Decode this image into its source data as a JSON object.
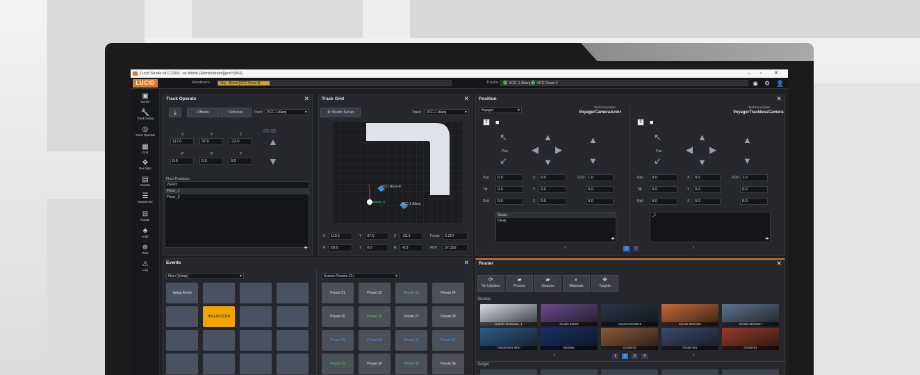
{
  "window": {
    "title": "Lucid Studio v4.0.2204 - as Admin [Administrator][port:5454]"
  },
  "appbar": {
    "logo": "LUCID",
    "renderers_label": "Renderers:",
    "renderer_chip": "Voy - Boost [VCC Ross-4]",
    "tracks_label": "Tracks:",
    "tracks": [
      "VCC-1 Alienj",
      "VCC Ross-4"
    ]
  },
  "sidebar": {
    "items": [
      {
        "label": "Server",
        "icon": "server-icon",
        "glyph": "▣"
      },
      {
        "label": "Track Setup",
        "icon": "wrench-icon",
        "glyph": "🔧"
      },
      {
        "label": "Track Operate",
        "icon": "target-icon",
        "glyph": "◎"
      },
      {
        "label": "Grid",
        "icon": "grid-icon",
        "glyph": "▦"
      },
      {
        "label": "Pos Man",
        "icon": "move-icon",
        "glyph": "✥"
      },
      {
        "label": "Events",
        "icon": "events-icon",
        "glyph": "▤"
      },
      {
        "label": "Sequencer",
        "icon": "sequencer-icon",
        "glyph": "☰"
      },
      {
        "label": "Router",
        "icon": "router-icon",
        "glyph": "⊟"
      },
      {
        "label": "Logic",
        "icon": "logic-icon",
        "glyph": "♣"
      },
      {
        "label": "Web",
        "icon": "web-icon",
        "glyph": "⊕"
      },
      {
        "label": "Log",
        "icon": "warning-icon",
        "glyph": "⚠"
      }
    ]
  },
  "track_operate": {
    "title": "Track Operate",
    "offsets": "Offsets",
    "defocus": "Defocus",
    "track_label": "Track:",
    "track_value": "VCC-1 Alienj",
    "xyz_labels": [
      "X",
      "Y",
      "Z"
    ],
    "xyz": [
      "117.0",
      "37.0",
      "-23.0"
    ],
    "prp_labels": [
      "P",
      "R",
      "F"
    ],
    "prp": [
      "0.0",
      "0.0",
      "0.0"
    ],
    "floor_label": "Floor Positions:",
    "floor_positions": [
      "ZERO",
      "Floor_1",
      "Floor_2"
    ]
  },
  "track_grid": {
    "title": "Track Grid",
    "studio_setup": "Studio Setup",
    "track_label": "Track:",
    "track_value": "VCC-1 Alienj",
    "cam1": "VCC Ross-4",
    "cam2": "VCC-1 Alienj",
    "axis_z": "Z",
    "axis_x": "X",
    "x_label": "X",
    "x": "119.1",
    "y_label": "Y",
    "y": "37.0",
    "z_label": "Z",
    "z": "-23.3",
    "focus_label": "Focus",
    "focus": "2.207",
    "p_label": "P",
    "p": "28.0",
    "t_label": "T",
    "t": "0.0",
    "r_label": "R",
    "r": "-0.0",
    "fov_label": "FOV",
    "fov": "37.322"
  },
  "position": {
    "title": "Position",
    "group": "Voyager",
    "left": {
      "set": "TechCrunchSet",
      "camera": "VoyagerCameraActor",
      "presets": [
        "Seats",
        "Desk"
      ]
    },
    "right": {
      "set": "TechCrunchSet",
      "camera": "VoyagerTracklessCamera",
      "presets": [
        "_1"
      ]
    },
    "pan_label": "Pan",
    "tilt_label": "Tilt",
    "roll_label": "Roll",
    "x_label": "X",
    "y_label": "Y",
    "z_label": "Z",
    "fov_label": "FOV",
    "pan": "0.0",
    "tilt": "0.0",
    "roll": "0.0",
    "x": "0.0",
    "y": "0.0",
    "z": "0.0",
    "fov": "1.0",
    "f2": "0.0",
    "f3": "0.0",
    "pages": [
      "1",
      "2"
    ],
    "prev": "‹",
    "next": "›"
  },
  "events": {
    "title": "Events",
    "group": "Main (Setup)",
    "setup_event": "Setup Event",
    "host_all": "Host All SCRN",
    "screen_presets": "Screen Presets 21+",
    "presets": [
      {
        "label": "Preset 21",
        "color": "#e4e6ea"
      },
      {
        "label": "Preset 22",
        "color": "#e4e6ea"
      },
      {
        "label": "Preset 23",
        "color": "#5fd45f"
      },
      {
        "label": "Preset 24",
        "color": "#e4e6ea"
      },
      {
        "label": "Preset 25",
        "color": "#e4e6ea"
      },
      {
        "label": "Preset 26",
        "color": "#5fd45f"
      },
      {
        "label": "Preset 27",
        "color": "#e4e6ea"
      },
      {
        "label": "Preset 28",
        "color": "#e4e6ea"
      },
      {
        "label": "Preset 29",
        "color": "#4aa3ff"
      },
      {
        "label": "Preset 30",
        "color": "#4aa3ff"
      },
      {
        "label": "Preset 31",
        "color": "#4aa3ff"
      },
      {
        "label": "Preset 32",
        "color": "#4aa3ff"
      },
      {
        "label": "Preset 33",
        "color": "#5fd45f"
      },
      {
        "label": "Preset 34",
        "color": "#e4e6ea"
      },
      {
        "label": "Preset 35",
        "color": "#5fd45f"
      },
      {
        "label": "Preset 36",
        "color": "#e4e6ea"
      }
    ]
  },
  "router": {
    "title": "Router",
    "buttons": [
      "No Updates",
      "Presets",
      "Sources",
      "Materials",
      "Targets"
    ],
    "source_label": "Source",
    "target_label": "Target",
    "sources": [
      "Isabelle-landscape_1",
      "Clouds-6422/3",
      "Clouds-8422/6012",
      "Clouds-8021/401",
      "Clouds-44/2/4447",
      "Clouds-8001 9897",
      "Mediatec",
      "Clouds-02",
      "Clouds-801",
      "Clouds-82"
    ],
    "pages": [
      "1",
      "2",
      "3",
      "4"
    ],
    "prev": "‹",
    "next": "›"
  }
}
